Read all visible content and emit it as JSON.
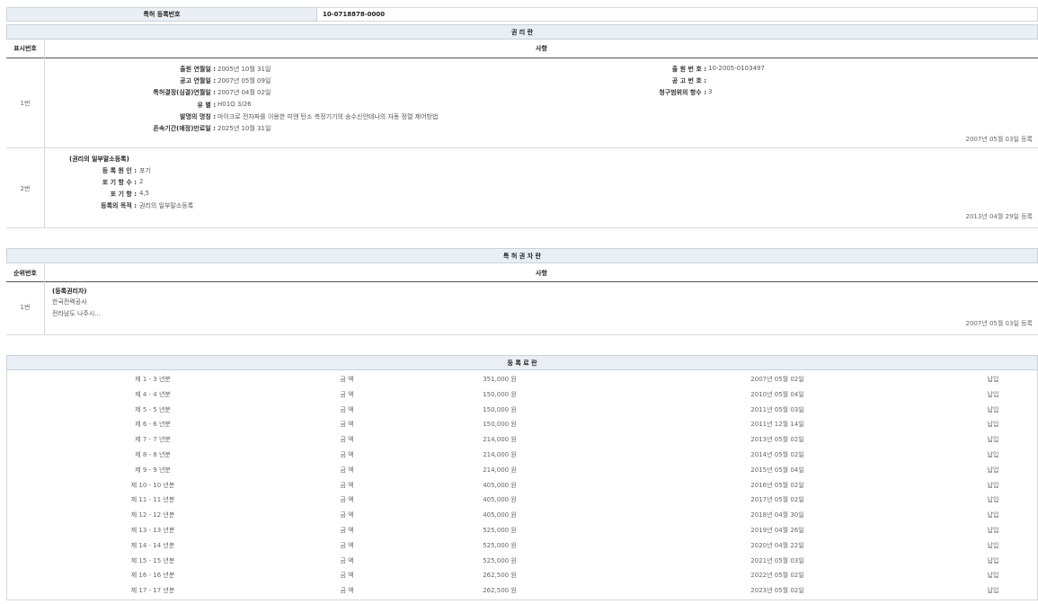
{
  "header": {
    "reg_label": "특허 등록번호",
    "reg_value": "10-0718878-0000"
  },
  "rights_section": {
    "title": "권 리 란",
    "col_num": "표시번호",
    "col_content": "사항",
    "entry1": {
      "num": "1번",
      "labels": {
        "filing_date": "출원 연월일 :",
        "pub_date": "공고 연월일 :",
        "grant_date": "특허결정(심결)연월일 :",
        "ipc": "유 별 :",
        "title": "발명의 명칭 :",
        "expiry": "존속기간(예정)만료일 :",
        "filing_no": "출 원 번 호 :",
        "pub_no": "공 고 번 호 :",
        "claims": "청구범위의 항수 :"
      },
      "values": {
        "filing_date": "2005년 10월 31일",
        "pub_date": "2007년 05월 09일",
        "grant_date": "2007년 04월 02일",
        "ipc": "H01Q 3/26",
        "title": "마이크로 전자파를 이용한 미엔 탄소 측정기기의 송수신안테나의 자동 정렬 제어방법",
        "expiry": "2025년 10월 31일",
        "filing_no": "10-2005-0103497",
        "pub_no": "",
        "claims": "3"
      },
      "registered": "2007년 05월 03일 등록"
    },
    "entry2": {
      "num": "2번",
      "heading": "(권리의 일부말소등록)",
      "labels": {
        "cause": "등 록 원 인 :",
        "waived_count": "포 기 항 수 :",
        "waived_claims": "포 기 항 :",
        "purpose": "등록의 목적 :"
      },
      "values": {
        "cause": "포기",
        "waived_count": "2",
        "waived_claims": "4,5",
        "purpose": "권리의 일부말소등록"
      },
      "registered": "2013년 04월 29일 등록"
    }
  },
  "holder_section": {
    "title": "특 허 권 자 란",
    "col_num": "순위번호",
    "col_content": "사항",
    "entry": {
      "num": "1번",
      "heading": "(등록권리자)",
      "name": "한국전력공사",
      "address": "전라남도 나주시...",
      "registered": "2007년 05월 03일 등록"
    }
  },
  "fee_section": {
    "title": "등 록 료 란",
    "rows": [
      {
        "period": "제 1 - 3 년분",
        "label": "금 액",
        "amount": "351,000 원",
        "date": "2007년 05월 02일",
        "status": "납입"
      },
      {
        "period": "제 4 - 4 년분",
        "label": "금 액",
        "amount": "150,000 원",
        "date": "2010년 05월 04일",
        "status": "납입"
      },
      {
        "period": "제 5 - 5 년분",
        "label": "금 액",
        "amount": "150,000 원",
        "date": "2011년 05월 03일",
        "status": "납입"
      },
      {
        "period": "제 6 - 6 년분",
        "label": "금 액",
        "amount": "150,000 원",
        "date": "2011년 12월 14일",
        "status": "납입"
      },
      {
        "period": "제 7 - 7 년분",
        "label": "금 액",
        "amount": "214,000 원",
        "date": "2013년 05월 02일",
        "status": "납입"
      },
      {
        "period": "제 8 - 8 년분",
        "label": "금 액",
        "amount": "214,000 원",
        "date": "2014년 05월 02일",
        "status": "납입"
      },
      {
        "period": "제 9 - 9 년분",
        "label": "금 액",
        "amount": "214,000 원",
        "date": "2015년 05월 04일",
        "status": "납입"
      },
      {
        "period": "제 10 - 10 년분",
        "label": "금 액",
        "amount": "405,000 원",
        "date": "2016년 05월 02일",
        "status": "납입"
      },
      {
        "period": "제 11 - 11 년분",
        "label": "금 액",
        "amount": "405,000 원",
        "date": "2017년 05월 02일",
        "status": "납입"
      },
      {
        "period": "제 12 - 12 년분",
        "label": "금 액",
        "amount": "405,000 원",
        "date": "2018년 04월 30일",
        "status": "납입"
      },
      {
        "period": "제 13 - 13 년분",
        "label": "금 액",
        "amount": "525,000 원",
        "date": "2019년 04월 26일",
        "status": "납입"
      },
      {
        "period": "제 14 - 14 년분",
        "label": "금 액",
        "amount": "525,000 원",
        "date": "2020년 04월 22일",
        "status": "납입"
      },
      {
        "period": "제 15 - 15 년분",
        "label": "금 액",
        "amount": "525,000 원",
        "date": "2021년 05월 03일",
        "status": "납입"
      },
      {
        "period": "제 16 - 16 년분",
        "label": "금 액",
        "amount": "262,500 원",
        "date": "2022년 05월 02일",
        "status": "납입"
      },
      {
        "period": "제 17 - 17 년분",
        "label": "금 액",
        "amount": "262,500 원",
        "date": "2023년 05월 02일",
        "status": "납입"
      }
    ]
  }
}
